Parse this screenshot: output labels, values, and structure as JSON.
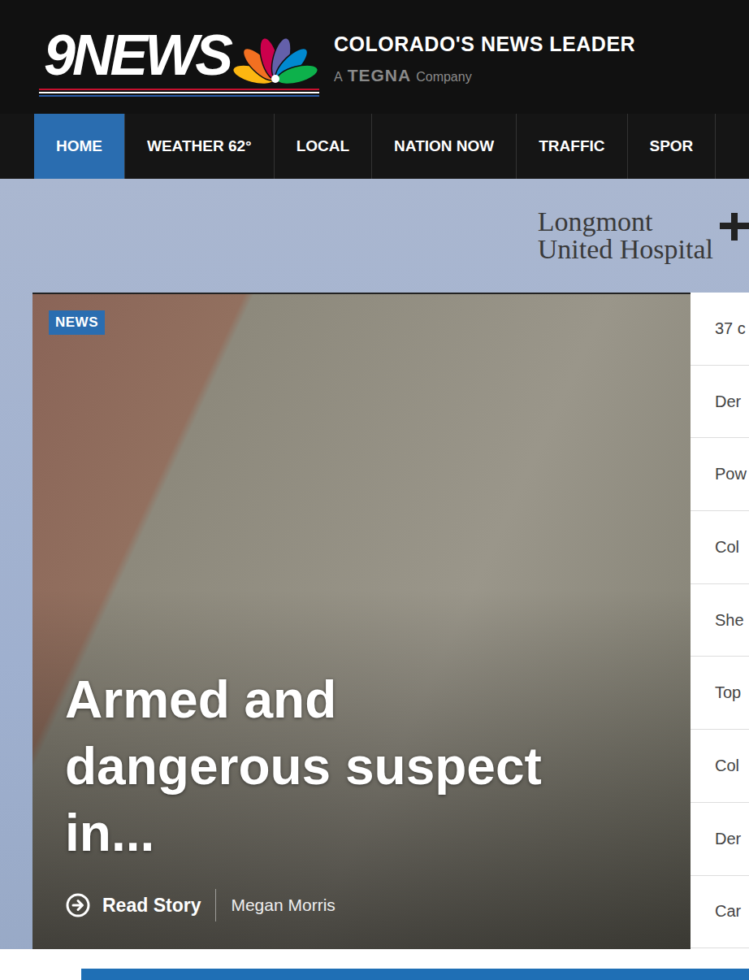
{
  "header": {
    "logo": "9NEWS",
    "tagline": "COLORADO'S NEWS LEADER",
    "company_prefix": "A",
    "company": "TEGNA",
    "company_suffix": "Company"
  },
  "nav": [
    {
      "label": "HOME",
      "selected": true
    },
    {
      "label": "WEATHER 62°",
      "selected": false
    },
    {
      "label": "LOCAL",
      "selected": false
    },
    {
      "label": "NATION NOW",
      "selected": false
    },
    {
      "label": "TRAFFIC",
      "selected": false
    },
    {
      "label": "SPOR",
      "selected": false
    }
  ],
  "ad": {
    "lines": [
      "Longmont",
      "United Hospital"
    ]
  },
  "hero": {
    "badge": "NEWS",
    "headline": "Armed and dangerous suspect in...",
    "action": "Read Story",
    "author": "Megan Morris"
  },
  "side_list": [
    {
      "label": "37 c"
    },
    {
      "label": "Der"
    },
    {
      "label": "Pow"
    },
    {
      "label": "Col"
    },
    {
      "label": "She"
    },
    {
      "label": "Top"
    },
    {
      "label": "Col"
    },
    {
      "label": "Der"
    },
    {
      "label": "Car"
    }
  ]
}
